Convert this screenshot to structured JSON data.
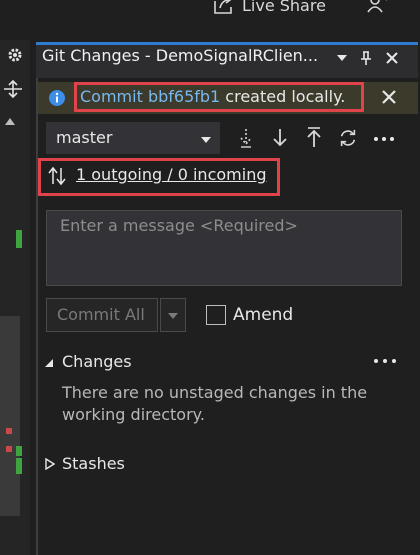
{
  "top": {
    "live_share_label": "Live Share"
  },
  "panel": {
    "title": "Git Changes - DemoSignalRClien..."
  },
  "infobar": {
    "prefix": "Commit ",
    "commit_hash": "bbf65fb1",
    "suffix": " created locally."
  },
  "branch": {
    "name": "master"
  },
  "sync": {
    "status": "1 outgoing / 0 incoming"
  },
  "message": {
    "placeholder": "Enter a message <Required>"
  },
  "commit": {
    "commit_all_label": "Commit All",
    "amend_label": "Amend"
  },
  "changes": {
    "label": "Changes",
    "empty_text": "There are no unstaged changes in the working directory."
  },
  "stashes": {
    "label": "Stashes"
  },
  "colors": {
    "accent": "#2f7bd1",
    "highlight": "#e0434a",
    "link": "#79b8ef",
    "info_bar": "#3c3a2a"
  }
}
